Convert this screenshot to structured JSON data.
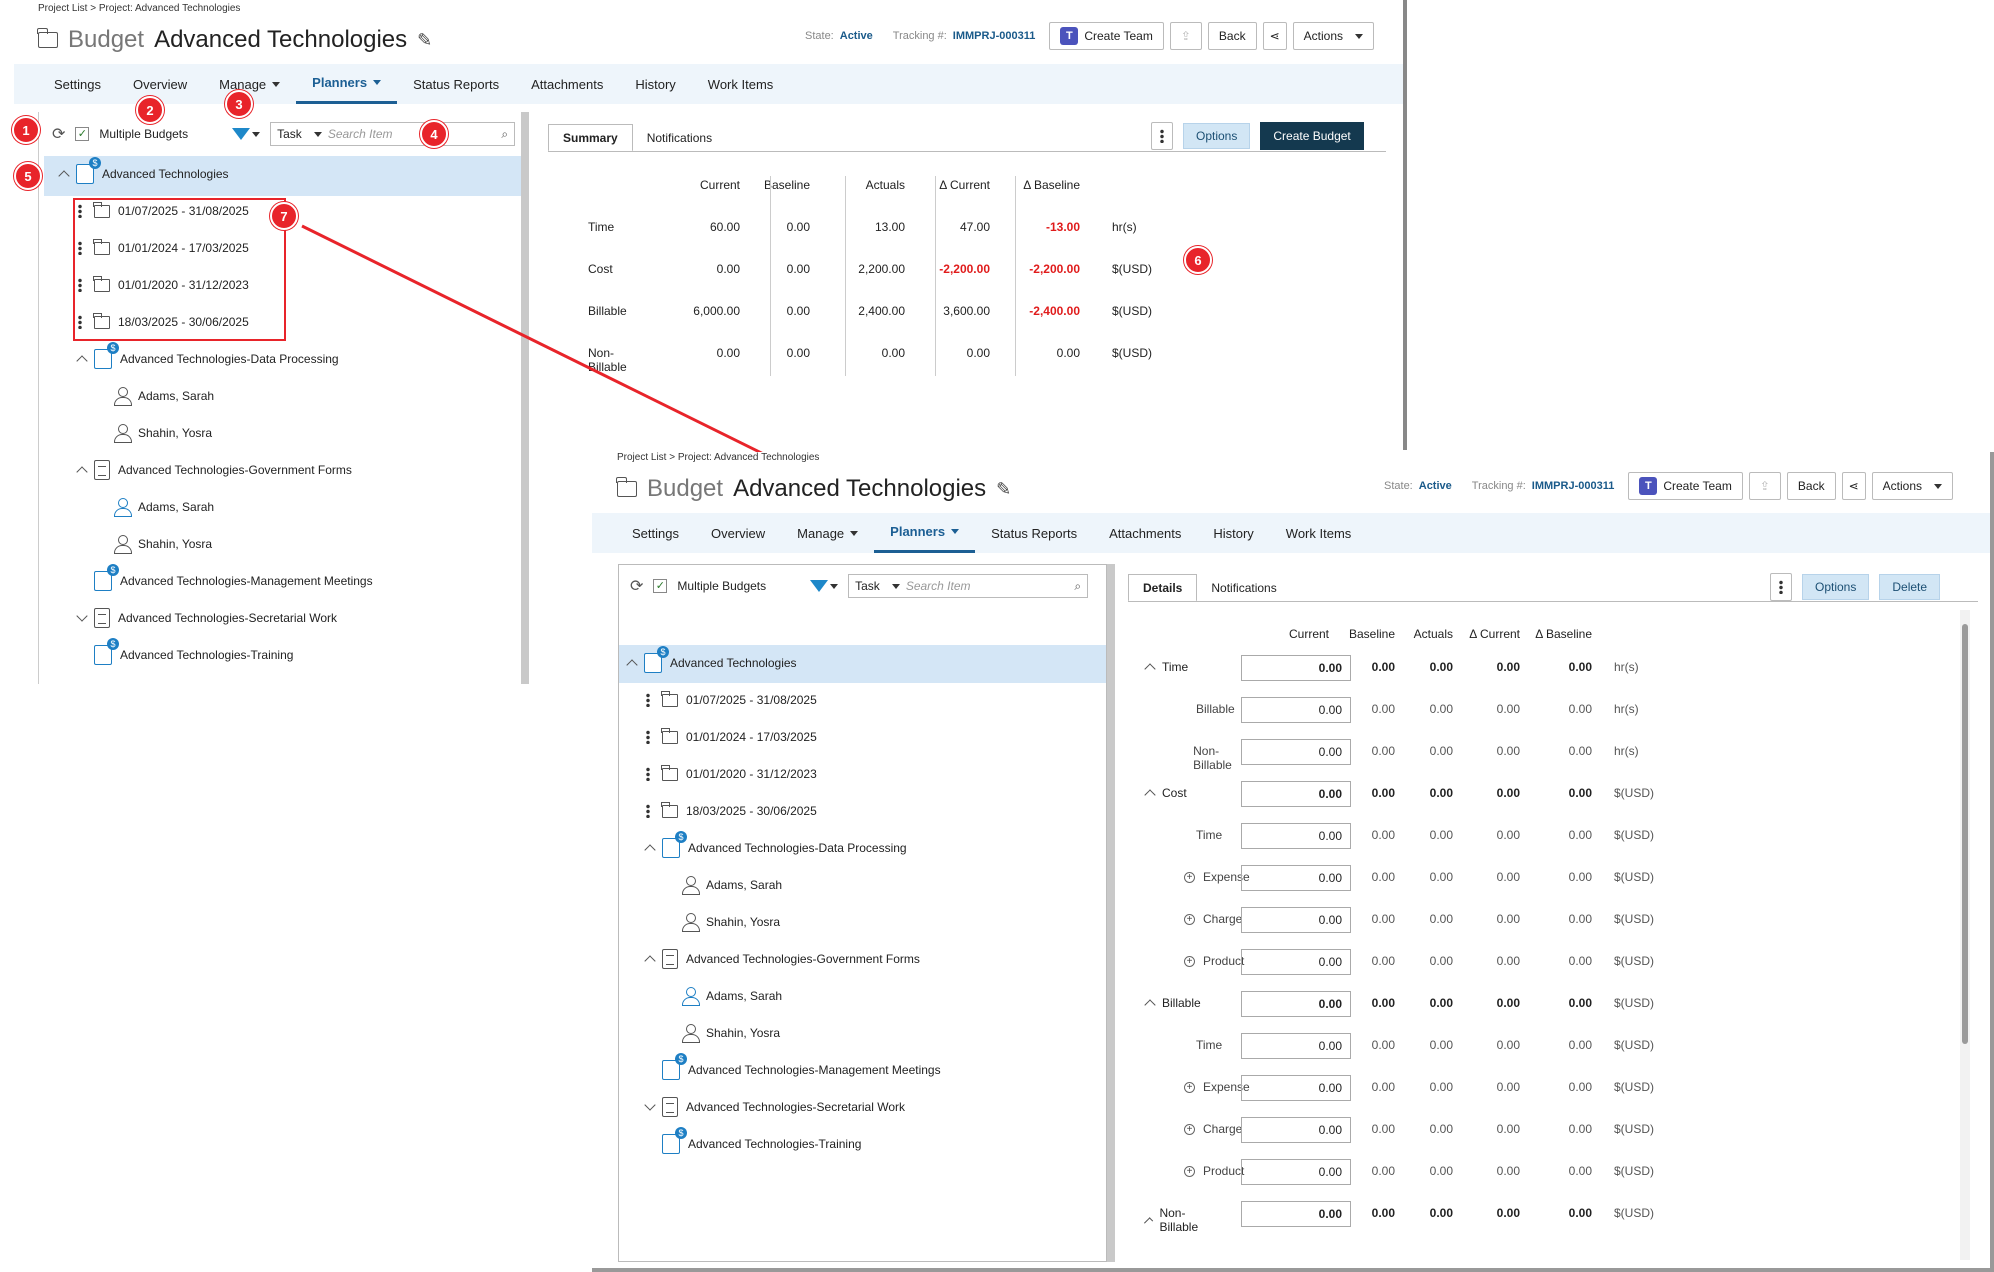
{
  "back_panel": {
    "breadcrumb": "Project List > Project: Advanced Technologies",
    "kind": "Budget",
    "name": "Advanced Technologies",
    "state_label": "State:",
    "state": "Active",
    "tracking_label": "Tracking #:",
    "tracking": "IMMPRJ-000311",
    "create_team": "Create Team",
    "back": "Back",
    "actions": "Actions",
    "nav": [
      "Settings",
      "Overview",
      "Manage",
      "Planners",
      "Status Reports",
      "Attachments",
      "History",
      "Work Items"
    ],
    "multiple_budgets": "Multiple Budgets",
    "search_type": "Task",
    "search_placeholder": "Search Item",
    "tabs": [
      "Summary",
      "Notifications"
    ],
    "options": "Options",
    "create_budget": "Create Budget",
    "tree": [
      "Advanced Technologies",
      "01/07/2025 - 31/08/2025",
      "01/01/2024 - 17/03/2025",
      "01/01/2020 - 31/12/2023",
      "18/03/2025 - 30/06/2025",
      "Advanced Technologies-Data Processing",
      "Adams, Sarah",
      "Shahin, Yosra",
      "Advanced Technologies-Government Forms",
      "Adams, Sarah",
      "Shahin, Yosra",
      "Advanced Technologies-Management Meetings",
      "Advanced Technologies-Secretarial Work",
      "Advanced Technologies-Training"
    ],
    "summary": {
      "columns": [
        "Current",
        "Baseline",
        "Actuals",
        "Δ Current",
        "Δ Baseline"
      ],
      "rows": [
        {
          "label": "Time",
          "values": [
            "60.00",
            "0.00",
            "13.00",
            "47.00",
            "-13.00"
          ],
          "unit": "hr(s)"
        },
        {
          "label": "Cost",
          "values": [
            "0.00",
            "0.00",
            "2,200.00",
            "-2,200.00",
            "-2,200.00"
          ],
          "unit": "$(USD)"
        },
        {
          "label": "Billable",
          "values": [
            "6,000.00",
            "0.00",
            "2,400.00",
            "3,600.00",
            "-2,400.00"
          ],
          "unit": "$(USD)"
        },
        {
          "label": "Non-Billable",
          "values": [
            "0.00",
            "0.00",
            "0.00",
            "0.00",
            "0.00"
          ],
          "unit": "$(USD)"
        }
      ]
    },
    "badges": [
      "1",
      "2",
      "3",
      "4",
      "5",
      "6",
      "7"
    ]
  },
  "front_panel": {
    "breadcrumb": "Project List > Project: Advanced Technologies",
    "kind": "Budget",
    "name": "Advanced Technologies",
    "state_label": "State:",
    "state": "Active",
    "tracking_label": "Tracking #:",
    "tracking": "IMMPRJ-000311",
    "create_team": "Create Team",
    "back": "Back",
    "actions": "Actions",
    "nav": [
      "Settings",
      "Overview",
      "Manage",
      "Planners",
      "Status Reports",
      "Attachments",
      "History",
      "Work Items"
    ],
    "multiple_budgets": "Multiple Budgets",
    "search_type": "Task",
    "search_placeholder": "Search Item",
    "tabs": [
      "Details",
      "Notifications"
    ],
    "options": "Options",
    "delete": "Delete",
    "tree": [
      "Advanced Technologies",
      "01/07/2025 - 31/08/2025",
      "01/01/2024 - 17/03/2025",
      "01/01/2020 - 31/12/2023",
      "18/03/2025 - 30/06/2025",
      "Advanced Technologies-Data Processing",
      "Adams, Sarah",
      "Shahin, Yosra",
      "Advanced Technologies-Government Forms",
      "Adams, Sarah",
      "Shahin, Yosra",
      "Advanced Technologies-Management Meetings",
      "Advanced Technologies-Secretarial Work",
      "Advanced Technologies-Training"
    ],
    "details": {
      "columns": [
        "Current",
        "Baseline",
        "Actuals",
        "Δ Current",
        "Δ Baseline"
      ],
      "rows": [
        {
          "label": "Time",
          "group": true,
          "current": "0.00",
          "rest": [
            "0.00",
            "0.00",
            "0.00",
            "0.00"
          ],
          "unit": "hr(s)"
        },
        {
          "label": "Billable",
          "group": false,
          "current": "0.00",
          "rest": [
            "0.00",
            "0.00",
            "0.00",
            "0.00"
          ],
          "unit": "hr(s)"
        },
        {
          "label": "Non-Billable",
          "group": false,
          "current": "0.00",
          "rest": [
            "0.00",
            "0.00",
            "0.00",
            "0.00"
          ],
          "unit": "hr(s)"
        },
        {
          "label": "Cost",
          "group": true,
          "current": "0.00",
          "rest": [
            "0.00",
            "0.00",
            "0.00",
            "0.00"
          ],
          "unit": "$(USD)"
        },
        {
          "label": "Time",
          "group": false,
          "current": "0.00",
          "rest": [
            "0.00",
            "0.00",
            "0.00",
            "0.00"
          ],
          "unit": "$(USD)"
        },
        {
          "label": "Expense",
          "group": false,
          "plus": true,
          "current": "0.00",
          "rest": [
            "0.00",
            "0.00",
            "0.00",
            "0.00"
          ],
          "unit": "$(USD)"
        },
        {
          "label": "Charge",
          "group": false,
          "plus": true,
          "current": "0.00",
          "rest": [
            "0.00",
            "0.00",
            "0.00",
            "0.00"
          ],
          "unit": "$(USD)"
        },
        {
          "label": "Product",
          "group": false,
          "plus": true,
          "current": "0.00",
          "rest": [
            "0.00",
            "0.00",
            "0.00",
            "0.00"
          ],
          "unit": "$(USD)"
        },
        {
          "label": "Billable",
          "group": true,
          "current": "0.00",
          "rest": [
            "0.00",
            "0.00",
            "0.00",
            "0.00"
          ],
          "unit": "$(USD)"
        },
        {
          "label": "Time",
          "group": false,
          "current": "0.00",
          "rest": [
            "0.00",
            "0.00",
            "0.00",
            "0.00"
          ],
          "unit": "$(USD)"
        },
        {
          "label": "Expense",
          "group": false,
          "plus": true,
          "current": "0.00",
          "rest": [
            "0.00",
            "0.00",
            "0.00",
            "0.00"
          ],
          "unit": "$(USD)"
        },
        {
          "label": "Charge",
          "group": false,
          "plus": true,
          "current": "0.00",
          "rest": [
            "0.00",
            "0.00",
            "0.00",
            "0.00"
          ],
          "unit": "$(USD)"
        },
        {
          "label": "Product",
          "group": false,
          "plus": true,
          "current": "0.00",
          "rest": [
            "0.00",
            "0.00",
            "0.00",
            "0.00"
          ],
          "unit": "$(USD)"
        },
        {
          "label": "Non-Billable",
          "group": true,
          "current": "0.00",
          "rest": [
            "0.00",
            "0.00",
            "0.00",
            "0.00"
          ],
          "unit": "$(USD)"
        }
      ]
    }
  }
}
